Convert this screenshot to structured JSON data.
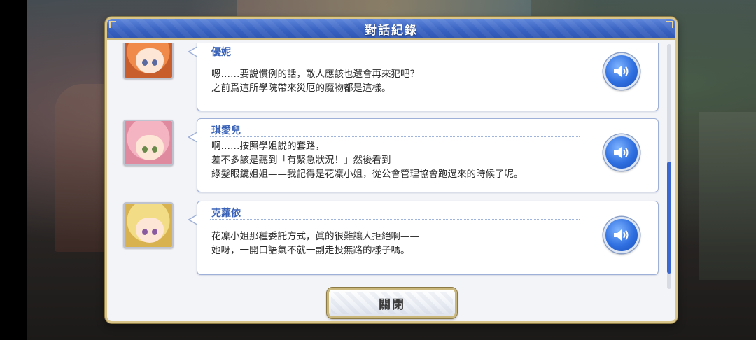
{
  "dialog": {
    "title": "對話紀錄",
    "close_label": "關閉"
  },
  "entries": [
    {
      "speaker": "優妮",
      "lines": [
        "嗯……要說慣例的話，敵人應該也還會再來犯吧？",
        "之前爲這所學院帶來災厄的魔物都是這樣。"
      ],
      "voice_icon": "speaker-volume-icon",
      "portrait_icon": "character-portrait-yuni"
    },
    {
      "speaker": "琪愛兒",
      "lines": [
        "啊……按照學姐說的套路，",
        "差不多該是聽到「有緊急狀況！」然後看到",
        "綠髮眼鏡姐姐——我記得是花凜小姐，從公會管理協會跑過來的時候了呢。"
      ],
      "voice_icon": "speaker-volume-icon",
      "portrait_icon": "character-portrait-chieru"
    },
    {
      "speaker": "克蘿依",
      "lines": [
        "花凜小姐那種委託方式，眞的很難讓人拒絕啊——",
        "她呀，一開口語氣不就一副走投無路的樣子嗎。"
      ],
      "voice_icon": "speaker-volume-icon",
      "portrait_icon": "character-portrait-chloe"
    }
  ],
  "colors": {
    "header_blue": "#3a64c3",
    "speaker_blue": "#3a63b8",
    "gold_border": "#c9b77c",
    "scroll_thumb": "#3a67d0"
  }
}
